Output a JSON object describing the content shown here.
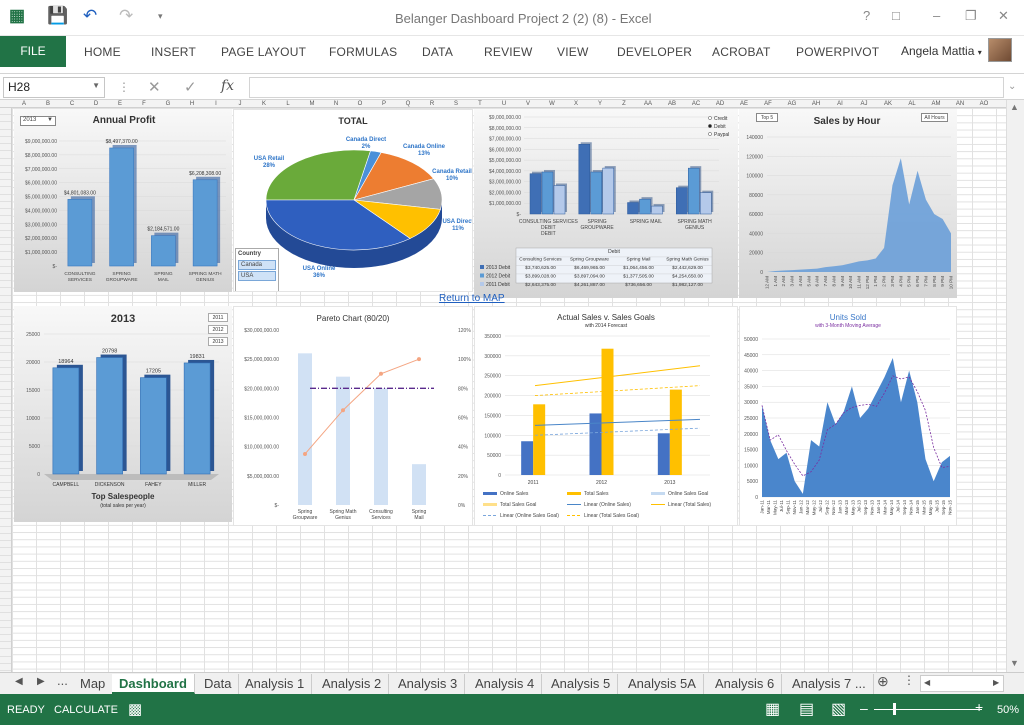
{
  "window": {
    "title": "Belanger Dashboard Project 2 (2) (8)  -  Excel"
  },
  "ribbon": {
    "file": "FILE",
    "tabs": [
      "HOME",
      "INSERT",
      "PAGE LAYOUT",
      "FORMULAS",
      "DATA",
      "REVIEW",
      "VIEW",
      "DEVELOPER",
      "ACROBAT",
      "POWERPIVOT"
    ],
    "user": "Angela Mattia"
  },
  "formula_bar": {
    "name_box": "H28",
    "fx": "fx",
    "formula": ""
  },
  "columns": [
    "A",
    "B",
    "C",
    "D",
    "E",
    "F",
    "G",
    "H",
    "I",
    "J",
    "K",
    "L",
    "M",
    "N",
    "O",
    "P",
    "Q",
    "R",
    "S",
    "T",
    "U",
    "V",
    "W",
    "X",
    "Y",
    "Z",
    "AA",
    "AB",
    "AC",
    "AD",
    "AE",
    "AF",
    "AG",
    "AH",
    "AI",
    "AJ",
    "AK",
    "AL",
    "AM",
    "AN",
    "AO"
  ],
  "link_text": "Return to MAP",
  "chart_data": [
    {
      "type": "bar",
      "title": "Annual Profit",
      "dropdown": "2013",
      "categories": [
        "CONSULTING SERVICES",
        "SPRING GROUPWARE",
        "SPRING MAIL",
        "SPRING MATH GENIUS"
      ],
      "values": [
        4801083,
        8497370,
        2184571,
        6208308
      ],
      "value_labels": [
        "$4,801,083.00",
        "$8,497,370.00",
        "$2,184,571.00",
        "$6,208,308.00"
      ],
      "ylim": [
        0,
        9000000
      ],
      "yticks": [
        "$-",
        "$1,000,000.00",
        "$2,000,000.00",
        "$3,000,000.00",
        "$4,000,000.00",
        "$5,000,000.00",
        "$6,000,000.00",
        "$7,000,000.00",
        "$8,000,000.00",
        "$9,000,000.00"
      ]
    },
    {
      "type": "pie",
      "title": "TOTAL",
      "slices": [
        {
          "label": "USA Online",
          "pct": "36%",
          "value": 36,
          "color": "#2f5fbf"
        },
        {
          "label": "USA Retail",
          "pct": "28%",
          "value": 28,
          "color": "#6aaa3a"
        },
        {
          "label": "Canada Direct",
          "pct": "2%",
          "value": 2,
          "color": "#4a90d9"
        },
        {
          "label": "Canada Online",
          "pct": "13%",
          "value": 13,
          "color": "#ed7d31"
        },
        {
          "label": "Canada Retail",
          "pct": "10%",
          "value": 10,
          "color": "#a5a5a5"
        },
        {
          "label": "USA Direct",
          "pct": "11%",
          "value": 11,
          "color": "#ffc000"
        }
      ],
      "filter": {
        "title": "Country",
        "items": [
          "Canada",
          "USA"
        ]
      }
    },
    {
      "type": "bar",
      "categories": [
        "CONSULTING SERVICES DEBIT",
        "SPRING GROUPWARE",
        "SPRING MAIL",
        "SPRING MATH GENIUS"
      ],
      "legend": [
        "Credit",
        "Debit",
        "Paypal"
      ],
      "series": [
        {
          "name": "2013 Debit",
          "values": [
            3740625,
            6469965,
            1064456,
            2442629
          ],
          "labels": [
            "$3,740,625.00",
            "$6,469,965.00",
            "$1,064,456.00",
            "$2,442,629.00"
          ]
        },
        {
          "name": "2012 Debit",
          "values": [
            3899028,
            3897094,
            1377505,
            4254650
          ],
          "labels": [
            "$3,899,028.00",
            "$3,897,094.00",
            "$1,377,505.00",
            "$4,254,650.00"
          ]
        },
        {
          "name": "2011 Debit",
          "values": [
            2643375,
            4261887,
            736656,
            1982127
          ],
          "labels": [
            "$2,643,375.00",
            "$4,261,887.00",
            "$736,656.00",
            "$1,982,127.00"
          ]
        }
      ],
      "table_header": "Debit",
      "table_cols": [
        "Consulting Services",
        "Spring Groupware",
        "Spring Mail",
        "Spring Math Genius"
      ],
      "ylim": [
        0,
        9000000
      ],
      "yticks": [
        "$-",
        "$1,000,000.00",
        "$2,000,000.00",
        "$3,000,000.00",
        "$4,000,000.00",
        "$5,000,000.00",
        "$6,000,000.00",
        "$7,000,000.00",
        "$8,000,000.00",
        "$9,000,000.00"
      ]
    },
    {
      "type": "area",
      "title": "Sales by Hour",
      "buttons": [
        "Top 5",
        "All Hours"
      ],
      "x": [
        "12 AM",
        "1 AM",
        "2 AM",
        "3 AM",
        "4 AM",
        "5 AM",
        "6 AM",
        "7 AM",
        "8 AM",
        "9 AM",
        "10 AM",
        "11 AM",
        "12 PM",
        "1 PM",
        "2 PM",
        "3 PM",
        "4 PM",
        "5 PM",
        "6 PM",
        "7 PM",
        "8 PM",
        "9 PM",
        "10 PM"
      ],
      "values": [
        0,
        1000,
        1500,
        2000,
        2500,
        3000,
        3500,
        5000,
        6000,
        7000,
        9000,
        11000,
        12000,
        14000,
        25000,
        90000,
        118000,
        70000,
        105000,
        75000,
        60000,
        55000,
        40000
      ],
      "ylim": [
        0,
        140000
      ],
      "yticks": [
        "0",
        "20000",
        "40000",
        "60000",
        "80000",
        "100000",
        "120000",
        "140000"
      ]
    },
    {
      "type": "bar",
      "title": "2013",
      "subtitle": "Top Salespeople",
      "note": "(total sales per year)",
      "buttons": [
        "2011",
        "2012",
        "2013"
      ],
      "categories": [
        "CAMPBELL",
        "DICKENSON",
        "FAHEY",
        "MILLER"
      ],
      "values": [
        18964,
        20798,
        17205,
        19831
      ],
      "ylim": [
        0,
        25000
      ],
      "yticks": [
        "0",
        "5000",
        "10000",
        "15000",
        "20000",
        "25000"
      ]
    },
    {
      "type": "bar",
      "title": "Pareto Chart (80/20)",
      "categories": [
        "Spring Groupware",
        "Spring Math Genius",
        "Consulting Services",
        "Spring Mail"
      ],
      "values": [
        26000000,
        22000000,
        20000000,
        7000000
      ],
      "cumulative_pct": [
        35,
        65,
        90,
        100
      ],
      "threshold": 80,
      "ylim": [
        0,
        30000000
      ],
      "yticks": [
        "$-",
        "$5,000,000.00",
        "$10,000,000.00",
        "$15,000,000.00",
        "$20,000,000.00",
        "$25,000,000.00",
        "$30,000,000.00"
      ],
      "y2ticks": [
        "0%",
        "20%",
        "40%",
        "60%",
        "80%",
        "100%",
        "120%"
      ]
    },
    {
      "type": "bar",
      "title": "Actual Sales v. Sales Goals",
      "subtitle": "with 2014 Forecast",
      "categories": [
        "2011",
        "2012",
        "2013"
      ],
      "series": [
        {
          "name": "Online Sales",
          "values": [
            85000,
            155000,
            105000
          ]
        },
        {
          "name": "Total Sales",
          "values": [
            178000,
            318000,
            215000
          ]
        },
        {
          "name": "Online Sales Goal",
          "values": [
            110000,
            120000,
            130000
          ]
        },
        {
          "name": "Total Sales Goal",
          "values": [
            200000,
            220000,
            240000
          ]
        }
      ],
      "legend": [
        "Online Sales",
        "Total Sales",
        "Online Sales Goal",
        "Total Sales Goal",
        "Linear (Online Sales)",
        "Linear (Total Sales)",
        "Linear (Online Sales Goal)",
        "Linear (Total Sales Goal)"
      ],
      "ylim": [
        0,
        350000
      ],
      "yticks": [
        "0",
        "50000",
        "100000",
        "150000",
        "200000",
        "250000",
        "300000",
        "350000"
      ]
    },
    {
      "type": "area",
      "title": "Units Sold",
      "subtitle": "with 3-Month Moving Average",
      "x": [
        "Jan-11",
        "Mar-11",
        "May-11",
        "Jul-11",
        "Sep-11",
        "Nov-11",
        "Jan-12",
        "Mar-12",
        "May-12",
        "Jul-12",
        "Sep-12",
        "Nov-12",
        "Jan-13",
        "Mar-13",
        "May-13",
        "Jul-13",
        "Sep-13",
        "Nov-13",
        "Jan-14",
        "Mar-14",
        "May-14",
        "Jul-14",
        "Sep-14",
        "Nov-14",
        "Jan-15",
        "Mar-15",
        "May-15",
        "Jul-15",
        "Sep-15",
        "Nov-15"
      ],
      "values": [
        29000,
        18000,
        12000,
        14000,
        5000,
        1000,
        18000,
        16000,
        30000,
        23000,
        27000,
        35000,
        25000,
        28000,
        33000,
        38000,
        44000,
        30000,
        40000,
        30000,
        12000,
        5000,
        11000,
        13000
      ],
      "ylim": [
        0,
        50000
      ],
      "yticks": [
        "0",
        "5000",
        "10000",
        "15000",
        "20000",
        "25000",
        "30000",
        "35000",
        "40000",
        "45000",
        "50000"
      ]
    }
  ],
  "sheet_tabs": [
    "Map",
    "Dashboard",
    "Data",
    "Analysis 1",
    "Analysis 2",
    "Analysis 3",
    "Analysis 4",
    "Analysis 5",
    "Analysis 5A",
    "Analysis 6",
    "Analysis 7 ..."
  ],
  "active_tab": "Dashboard",
  "status": {
    "ready": "READY",
    "calculate": "CALCULATE",
    "zoom": "50%"
  }
}
